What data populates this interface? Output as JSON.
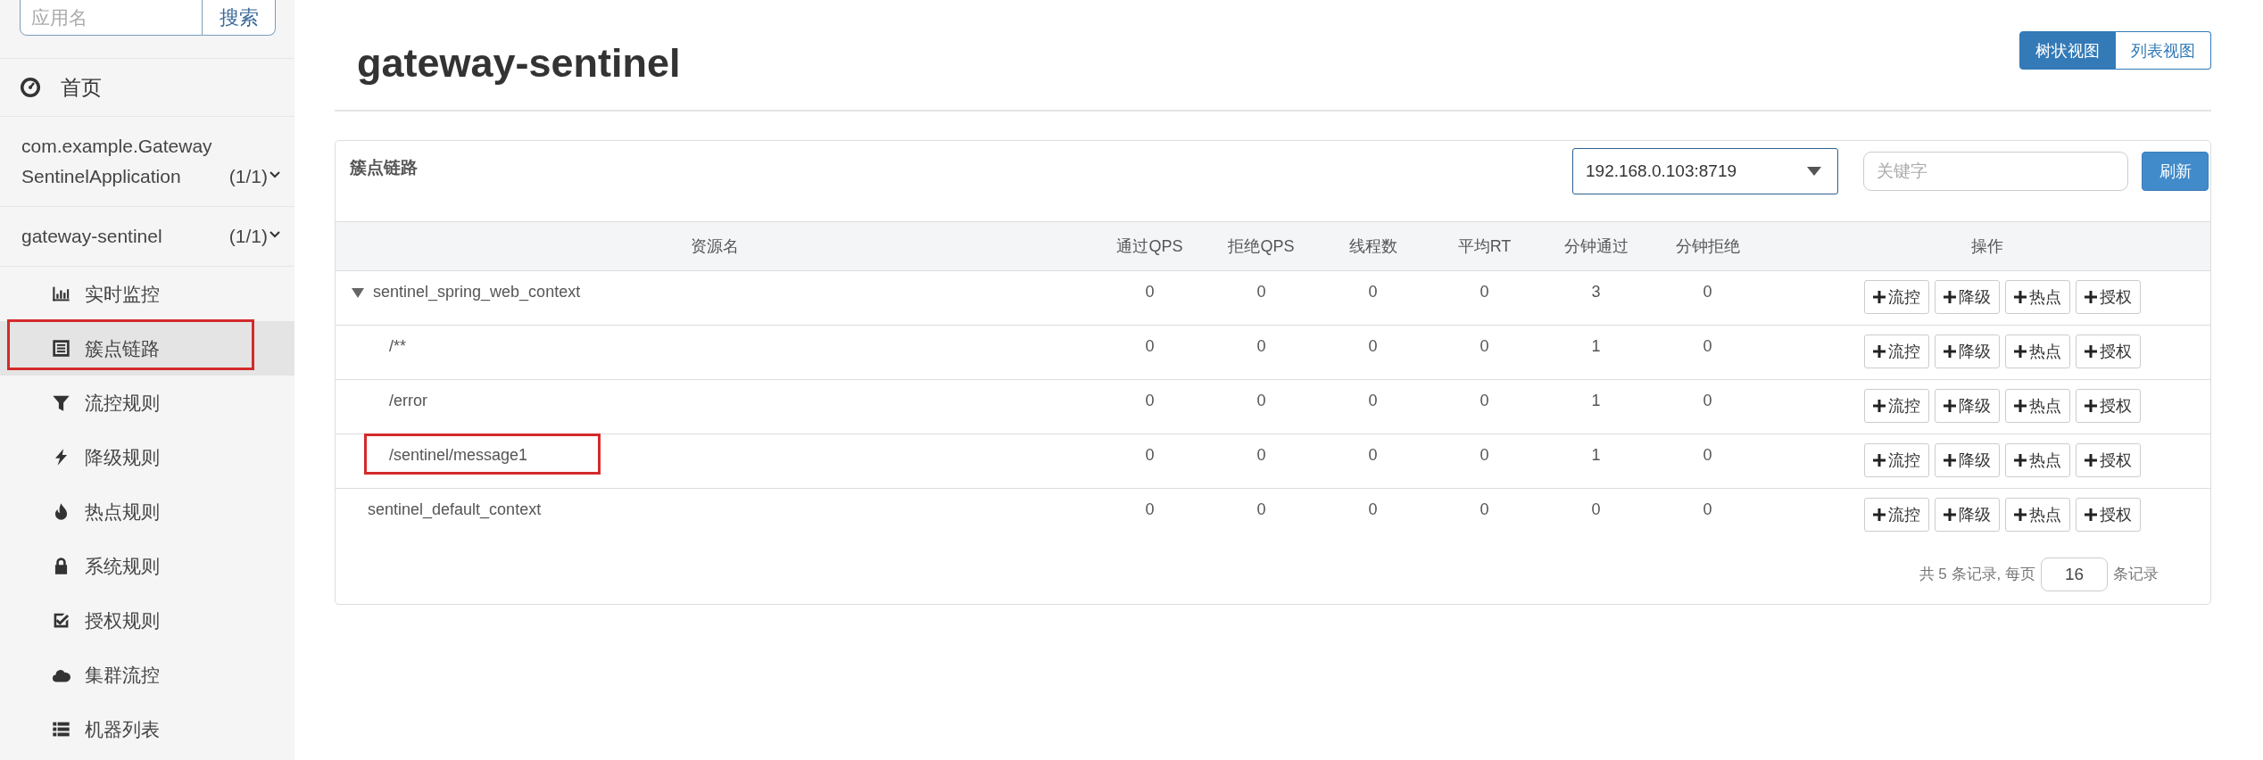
{
  "sidebar": {
    "search": {
      "placeholder": "应用名",
      "button": "搜索"
    },
    "home": {
      "label": "首页"
    },
    "apps": [
      {
        "name": "com.example.GatewaySentinelApplication",
        "count": "(1/1)"
      },
      {
        "name": "gateway-sentinel",
        "count": "(1/1)",
        "items": [
          {
            "label": "实时监控",
            "selected": false,
            "highlighted": false
          },
          {
            "label": "簇点链路",
            "selected": true,
            "highlighted": true
          },
          {
            "label": "流控规则",
            "selected": false,
            "highlighted": false
          },
          {
            "label": "降级规则",
            "selected": false,
            "highlighted": false
          },
          {
            "label": "热点规则",
            "selected": false,
            "highlighted": false
          },
          {
            "label": "系统规则",
            "selected": false,
            "highlighted": false
          },
          {
            "label": "授权规则",
            "selected": false,
            "highlighted": false
          },
          {
            "label": "集群流控",
            "selected": false,
            "highlighted": false
          },
          {
            "label": "机器列表",
            "selected": false,
            "highlighted": false
          }
        ]
      }
    ]
  },
  "main": {
    "title": "gateway-sentinel",
    "view_toggle": [
      {
        "label": "树状视图",
        "selected": true
      },
      {
        "label": "列表视图",
        "selected": false
      }
    ],
    "panel": {
      "title": "簇点链路",
      "machine": "192.168.0.103:8719",
      "search": {
        "placeholder": "关键字"
      },
      "refresh": "刷新",
      "columns": [
        "资源名",
        "通过QPS",
        "拒绝QPS",
        "线程数",
        "平均RT",
        "分钟通过",
        "分钟拒绝",
        "操作"
      ],
      "rows": [
        {
          "name": "sentinel_spring_web_context",
          "expanded": true,
          "highlighted": false,
          "values": [
            "0",
            "0",
            "0",
            "0",
            "3",
            "0"
          ],
          "actions": [
            "流控",
            "降级",
            "热点",
            "授权"
          ],
          "children": [
            {
              "name": "/**",
              "highlighted": false,
              "values": [
                "0",
                "0",
                "0",
                "0",
                "1",
                "0"
              ],
              "actions": [
                "流控",
                "降级",
                "热点",
                "授权"
              ]
            },
            {
              "name": "/error",
              "highlighted": false,
              "values": [
                "0",
                "0",
                "0",
                "0",
                "1",
                "0"
              ],
              "actions": [
                "流控",
                "降级",
                "热点",
                "授权"
              ]
            },
            {
              "name": "/sentinel/message1",
              "highlighted": true,
              "values": [
                "0",
                "0",
                "0",
                "0",
                "1",
                "0"
              ],
              "actions": [
                "流控",
                "降级",
                "热点",
                "授权"
              ]
            }
          ]
        },
        {
          "name": "sentinel_default_context",
          "highlighted": false,
          "values": [
            "0",
            "0",
            "0",
            "0",
            "0",
            "0"
          ],
          "actions": [
            "流控",
            "降级",
            "热点",
            "授权"
          ]
        }
      ],
      "pagination": {
        "summary": "共 5 条记录, 每页",
        "page_size": "16",
        "suffix": "条记录"
      }
    }
  }
}
